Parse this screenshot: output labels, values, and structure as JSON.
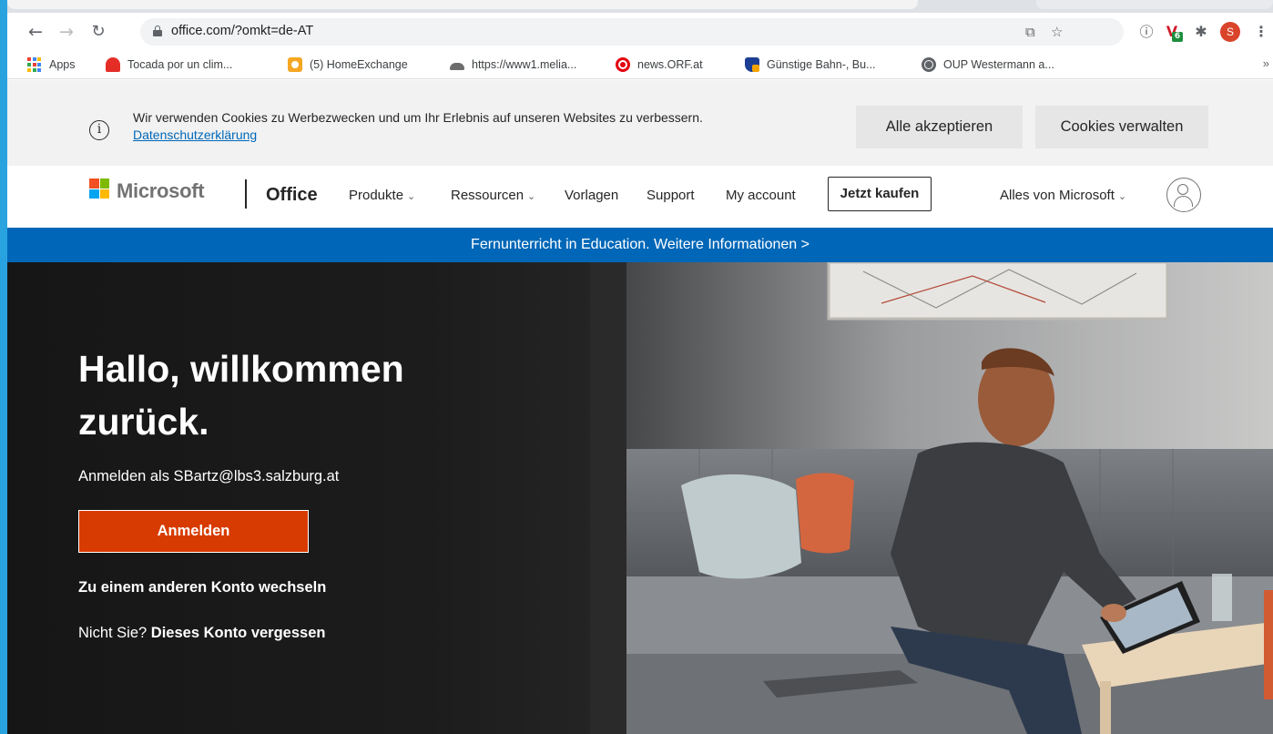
{
  "browser": {
    "url": "office.com/?omkt=de-AT",
    "profile_initial": "S",
    "extension_badge": "6",
    "bookmarks": [
      {
        "label": "Apps",
        "icon": "apps-grid-icon"
      },
      {
        "label": "Tocada por un clim...",
        "icon": "red-house-icon"
      },
      {
        "label": "(5) HomeExchange",
        "icon": "homeexchange-icon"
      },
      {
        "label": "https://www1.melia...",
        "icon": "melia-icon"
      },
      {
        "label": "news.ORF.at",
        "icon": "orf-icon"
      },
      {
        "label": "Günstige Bahn-, Bu...",
        "icon": "bahn-icon"
      },
      {
        "label": "OUP Westermann a...",
        "icon": "globe-icon"
      }
    ],
    "bookmarks_more": "»"
  },
  "cookie_banner": {
    "text": "Wir verwenden Cookies zu Werbezwecken und um Ihr Erlebnis auf unseren Websites zu verbessern.",
    "privacy_link": "Datenschutzerklärung",
    "accept_label": "Alle akzeptieren",
    "manage_label": "Cookies verwalten"
  },
  "header": {
    "brand": "Microsoft",
    "product": "Office",
    "nav": {
      "products": "Produkte",
      "resources": "Ressourcen",
      "templates": "Vorlagen",
      "support": "Support",
      "my_account": "My account"
    },
    "buy_label": "Jetzt kaufen",
    "all_microsoft": "Alles von Microsoft"
  },
  "banner": {
    "text": "Fernunterricht in Education. Weitere Informationen >"
  },
  "hero": {
    "title": "Hallo, willkommen zurück.",
    "signed_in_as": "Anmelden als SBartz@lbs3.salzburg.at",
    "signin_label": "Anmelden",
    "switch_account": "Zu einem anderen Konto wechseln",
    "not_you": "Nicht Sie?",
    "forget_account": "Dieses Konto vergessen"
  },
  "colors": {
    "accent_orange": "#d83b01",
    "banner_blue": "#0067b8",
    "ms_red": "#f25022",
    "ms_green": "#7fba00",
    "ms_blue": "#00a4ef",
    "ms_yellow": "#ffb900"
  }
}
